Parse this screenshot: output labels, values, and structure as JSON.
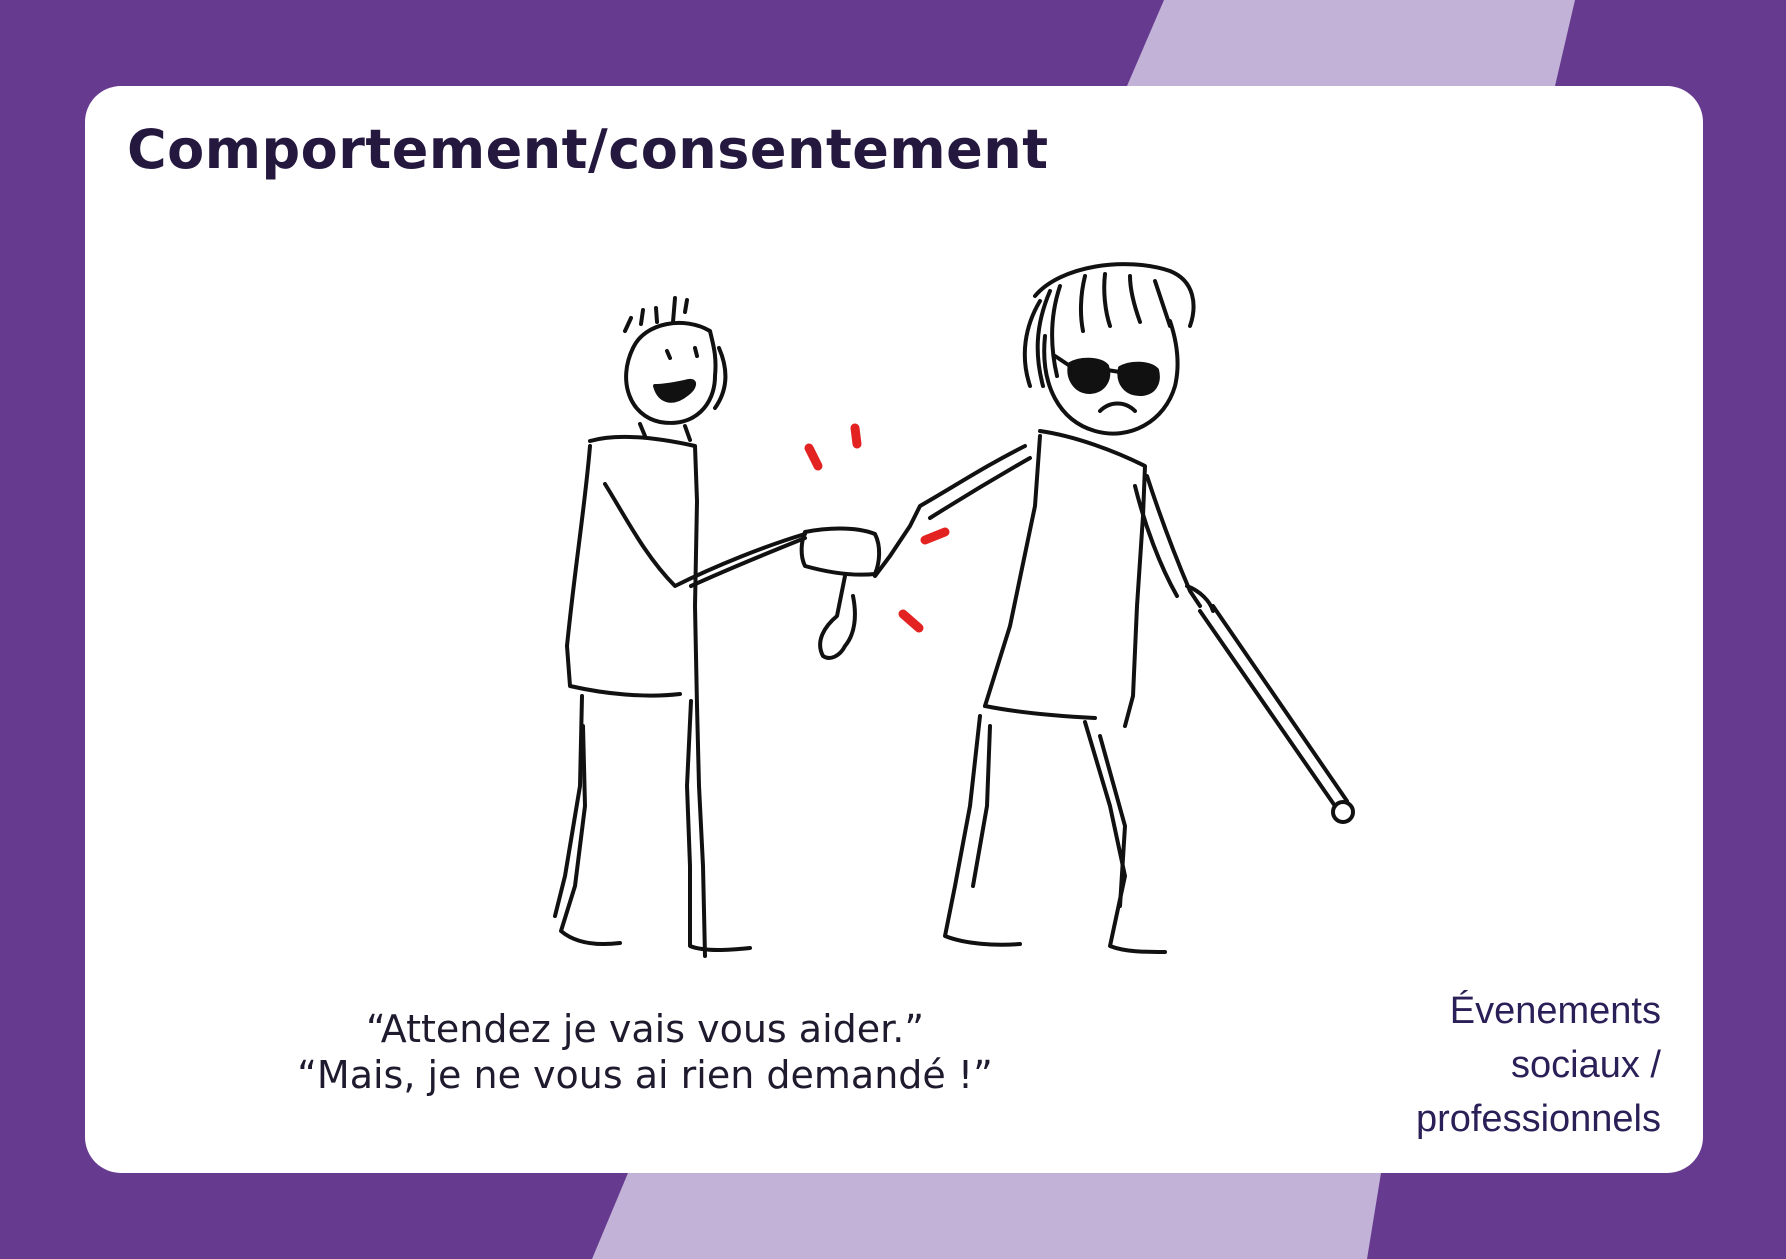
{
  "card": {
    "title": "Comportement/consentement",
    "caption": {
      "line1": "“Attendez je vais vous aider.”",
      "line2": "“Mais, je ne vous ai rien demandé !”"
    },
    "category": {
      "line1": "Évenements",
      "line2": "sociaux /",
      "line3": "professionnels"
    }
  },
  "colors": {
    "background_dark": "#663b8f",
    "background_light": "#c2b2d8",
    "title_text": "#25183f",
    "category_text": "#2b1f57",
    "accent_red": "#e32222"
  },
  "illustration": {
    "figures": [
      "helper-figure",
      "blind-person-figure"
    ],
    "props": [
      "white-cane",
      "dark-glasses"
    ]
  }
}
